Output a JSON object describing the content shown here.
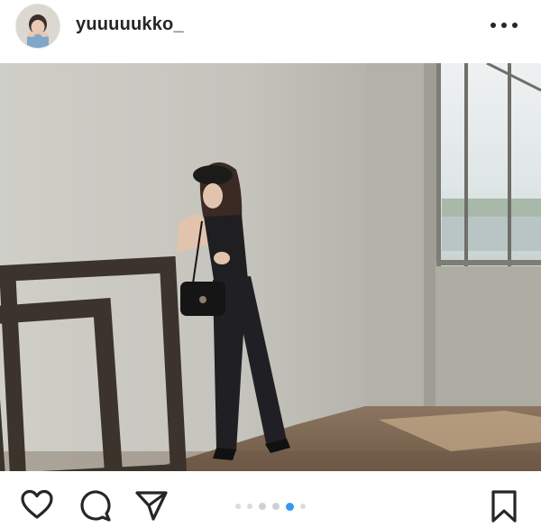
{
  "post": {
    "username": "yuuuuukko_",
    "avatar_alt": "profile-avatar",
    "more_icon": "more-horizontal-icon",
    "carousel": {
      "count": 6,
      "active_index": 4
    },
    "actions": [
      "heart-icon",
      "comment-icon",
      "share-icon",
      "bookmark-icon"
    ]
  },
  "colors": {
    "text": "#262626",
    "carousel_active": "#3897f0",
    "carousel_inactive": "#dbdbdb"
  }
}
